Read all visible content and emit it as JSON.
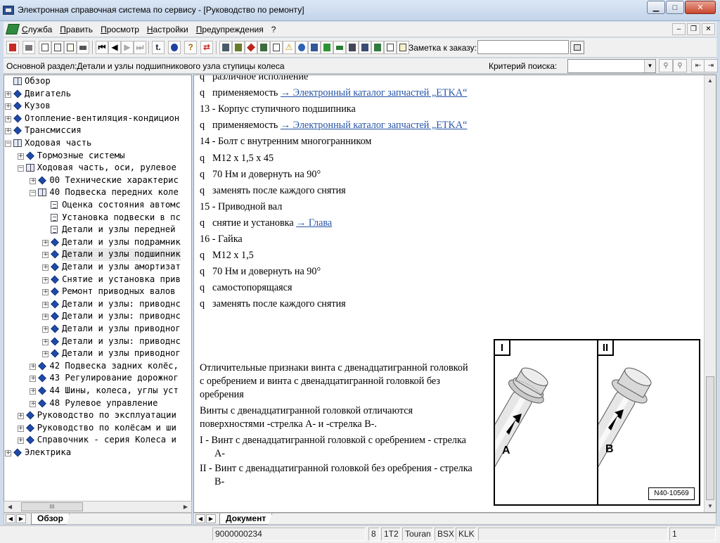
{
  "window": {
    "title": "Электронная справочная система по сервису - [Руководство по ремонту]",
    "minimize": "▁",
    "maximize": "□",
    "close": "✕"
  },
  "menu": {
    "items": [
      "Служба",
      "Править",
      "Просмотр",
      "Настройки",
      "Предупреждения",
      "?"
    ],
    "mdi_minimize": "–",
    "mdi_restore": "❐",
    "mdi_close": "✕"
  },
  "toolbar": {
    "order_label": "Заметка к заказу:",
    "order_value": ""
  },
  "section": {
    "label": "Основной раздел:Детали и узлы подшипникового узла ступицы колеса",
    "criteria_label": "Критерий  поиска:",
    "criteria_value": ""
  },
  "tree": {
    "items": [
      {
        "label": "Обзор",
        "level": 0,
        "icon": "book",
        "expander": ""
      },
      {
        "label": "Двигатель",
        "level": 0,
        "icon": "diamond",
        "expander": "+"
      },
      {
        "label": "Кузов",
        "level": 0,
        "icon": "diamond",
        "expander": "+"
      },
      {
        "label": "Отопление-вентиляция-кондицион",
        "level": 0,
        "icon": "diamond",
        "expander": "+"
      },
      {
        "label": "Трансмиссия",
        "level": 0,
        "icon": "diamond",
        "expander": "+"
      },
      {
        "label": "Ходовая часть",
        "level": 0,
        "icon": "book",
        "expander": "−"
      },
      {
        "label": "Тормозные системы",
        "level": 1,
        "icon": "diamond",
        "expander": "+"
      },
      {
        "label": "Ходовая часть, оси, рулевое",
        "level": 1,
        "icon": "book",
        "expander": "−"
      },
      {
        "label": "00 Технические характерис",
        "level": 2,
        "icon": "diamond",
        "expander": "+"
      },
      {
        "label": "40 Подвеска передних коле",
        "level": 2,
        "icon": "book",
        "expander": "−"
      },
      {
        "label": "Оценка состояния автомс",
        "level": 3,
        "icon": "doc",
        "expander": ""
      },
      {
        "label": "Установка подвески в пс",
        "level": 3,
        "icon": "doc",
        "expander": ""
      },
      {
        "label": "Детали и узлы передней",
        "level": 3,
        "icon": "doc",
        "expander": ""
      },
      {
        "label": "Детали и узлы подрамник",
        "level": 3,
        "icon": "diamond",
        "expander": "+"
      },
      {
        "label": "Детали и узлы подшипник",
        "level": 3,
        "icon": "diamond",
        "expander": "+",
        "selected": true
      },
      {
        "label": "Детали и узлы амортизат",
        "level": 3,
        "icon": "diamond",
        "expander": "+"
      },
      {
        "label": "Снятие и установка прив",
        "level": 3,
        "icon": "diamond",
        "expander": "+"
      },
      {
        "label": "Ремонт приводных валов",
        "level": 3,
        "icon": "diamond",
        "expander": "+"
      },
      {
        "label": "Детали и узлы: приводнс",
        "level": 3,
        "icon": "diamond",
        "expander": "+"
      },
      {
        "label": "Детали и узлы: приводнс",
        "level": 3,
        "icon": "diamond",
        "expander": "+"
      },
      {
        "label": "Детали и узлы приводног",
        "level": 3,
        "icon": "diamond",
        "expander": "+"
      },
      {
        "label": "Детали и узлы: приводнс",
        "level": 3,
        "icon": "diamond",
        "expander": "+"
      },
      {
        "label": "Детали и узлы приводног",
        "level": 3,
        "icon": "diamond",
        "expander": "+"
      },
      {
        "label": "42 Подвеска задних колёс,",
        "level": 2,
        "icon": "diamond",
        "expander": "+"
      },
      {
        "label": "43 Регулирование дорожног",
        "level": 2,
        "icon": "diamond",
        "expander": "+"
      },
      {
        "label": "44 Шины, колеса, углы уст",
        "level": 2,
        "icon": "diamond",
        "expander": "+"
      },
      {
        "label": "48 Рулевое управление",
        "level": 2,
        "icon": "diamond",
        "expander": "+"
      },
      {
        "label": "Руководство по эксплуатации",
        "level": 1,
        "icon": "diamond",
        "expander": "+"
      },
      {
        "label": "Руководство по колёсам и ши",
        "level": 1,
        "icon": "diamond",
        "expander": "+"
      },
      {
        "label": "Справочник - серия Колеса и",
        "level": 1,
        "icon": "diamond",
        "expander": "+"
      },
      {
        "label": "Электрика",
        "level": 0,
        "icon": "diamond",
        "expander": "+"
      }
    ],
    "tab": "Обзор"
  },
  "content": {
    "lines": [
      {
        "bullet": "q",
        "text": "различное исполнение",
        "link": ""
      },
      {
        "bullet": "q",
        "text": "применяемость ",
        "link": "→ Электронный каталог запчастей „ETKA“"
      },
      {
        "bullet": "",
        "text": "13 -  Корпус ступичного подшипника",
        "link": ""
      },
      {
        "bullet": "q",
        "text": "применяемость ",
        "link": "→ Электронный каталог запчастей „ETKA“"
      },
      {
        "bullet": "",
        "text": "14 -  Болт с внутренним многогранником",
        "link": ""
      },
      {
        "bullet": "q",
        "text": "M12 x 1,5 x 45",
        "link": ""
      },
      {
        "bullet": "q",
        "text": "70 Нм и довернуть на 90°",
        "link": ""
      },
      {
        "bullet": "q",
        "text": "заменять после каждого снятия",
        "link": ""
      },
      {
        "bullet": "",
        "text": "15 -  Приводной вал",
        "link": ""
      },
      {
        "bullet": "q",
        "text": "снятие и установка ",
        "link": "→ Глава"
      },
      {
        "bullet": "",
        "text": "16 -  Гайка",
        "link": ""
      },
      {
        "bullet": "q",
        "text": "M12 x 1,5",
        "link": ""
      },
      {
        "bullet": "q",
        "text": "70 Нм и довернуть на 90°",
        "link": ""
      },
      {
        "bullet": "q",
        "text": "самостопорящаяся",
        "link": ""
      },
      {
        "bullet": "q",
        "text": "заменять после каждого снятия",
        "link": ""
      }
    ],
    "desc_title": "Отличительные признаки винта с двенадцатигранной головкой с оребрением и винта с двенадцатигранной головкой без оребрения",
    "desc_text": "Винты с двенадцатигранной головкой отличаются поверхностями -стрелка А- и -стрелка В-.",
    "desc_item1": "I -  Винт с двенадцатигранной головкой с оребрением - стрелка А-",
    "desc_item2": "II -  Винт с двенадцатигранной головкой без оребрения - стрелка В-",
    "figure": {
      "label_left": "I",
      "label_right": "II",
      "arrow_left": "A",
      "arrow_right": "B",
      "code": "N40-10569"
    },
    "tab": "Документ"
  },
  "status": {
    "code": "9000000234",
    "cells": [
      "8",
      "1T2",
      "Touran",
      "BSX",
      "KLK"
    ],
    "page": "1"
  }
}
